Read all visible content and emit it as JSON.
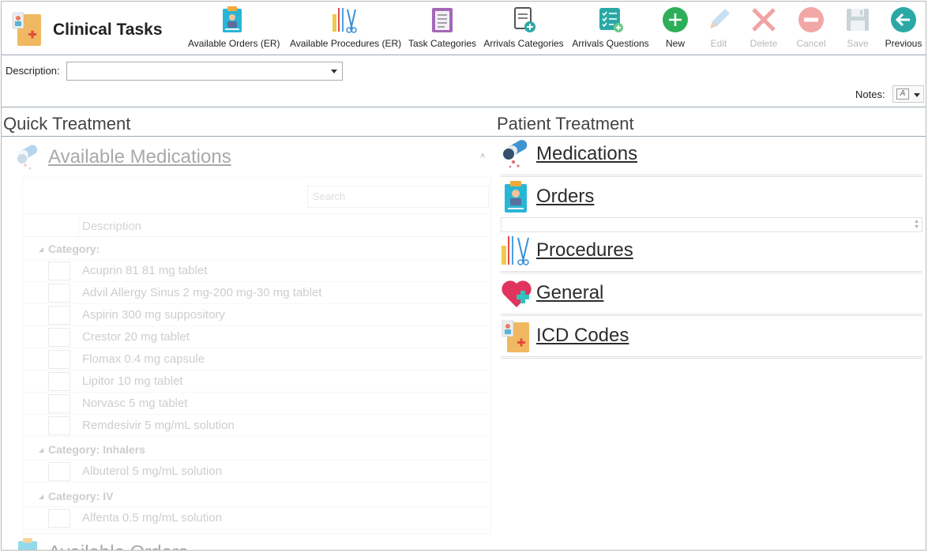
{
  "app": {
    "title": "Clinical Tasks"
  },
  "toolbar": [
    {
      "key": "available-orders",
      "label": "Available Orders (ER)",
      "icon": "clipboard-doctor-icon",
      "enabled": true
    },
    {
      "key": "available-procedures",
      "label": "Available Procedures (ER)",
      "icon": "surgical-tools-icon",
      "enabled": true
    },
    {
      "key": "task-categories",
      "label": "Task Categories",
      "icon": "checklist-clipboard-icon",
      "enabled": true
    },
    {
      "key": "arrivals-categories",
      "label": "Arrivals Categories",
      "icon": "document-add-icon",
      "enabled": true
    },
    {
      "key": "arrivals-questions",
      "label": "Arrivals Questions",
      "icon": "checklist-add-icon",
      "enabled": true
    },
    {
      "key": "new",
      "label": "New",
      "icon": "plus-circle-icon",
      "enabled": true
    },
    {
      "key": "edit",
      "label": "Edit",
      "icon": "pencil-icon",
      "enabled": false
    },
    {
      "key": "delete",
      "label": "Delete",
      "icon": "x-icon",
      "enabled": false
    },
    {
      "key": "cancel",
      "label": "Cancel",
      "icon": "minus-circle-icon",
      "enabled": false
    },
    {
      "key": "save",
      "label": "Save",
      "icon": "floppy-disk-icon",
      "enabled": false
    },
    {
      "key": "previous",
      "label": "Previous",
      "icon": "arrow-left-circle-icon",
      "enabled": true
    }
  ],
  "description": {
    "label": "Description:",
    "value": ""
  },
  "notes": {
    "label": "Notes:"
  },
  "sections": {
    "left": "Quick Treatment",
    "right": "Patient Treatment"
  },
  "available_medications": {
    "title": "Available Medications",
    "search_placeholder": "Search",
    "column_header": "Description",
    "groups": [
      {
        "label": "Category:",
        "items": [
          "Acuprin 81 81 mg tablet",
          "Advil Allergy Sinus 2 mg-200 mg-30 mg tablet",
          "Aspirin 300 mg suppository",
          "Crestor 20 mg tablet",
          "Flomax 0.4 mg capsule",
          "Lipitor 10 mg tablet",
          "Norvasc 5 mg tablet",
          "Remdesivir 5 mg/mL solution"
        ]
      },
      {
        "label": "Category: Inhalers",
        "items": [
          "Albuterol 5 mg/mL solution"
        ]
      },
      {
        "label": "Category: IV",
        "items": [
          "Alfenta 0.5 mg/mL solution"
        ]
      }
    ]
  },
  "next_section_partial": "Available Orders",
  "patient_treatment": [
    {
      "label": "Medications",
      "icon": "pills-icon"
    },
    {
      "label": "Orders",
      "icon": "clipboard-doctor-icon"
    },
    {
      "label": "Procedures",
      "icon": "surgical-tools-icon"
    },
    {
      "label": "General",
      "icon": "heart-plus-icon"
    },
    {
      "label": "ICD Codes",
      "icon": "medical-folder-icon"
    }
  ],
  "colors": {
    "accent_green": "#2fae5a",
    "accent_teal": "#2aa8a6",
    "disabled": "#b8b8b8",
    "border": "#9aa8b4"
  }
}
